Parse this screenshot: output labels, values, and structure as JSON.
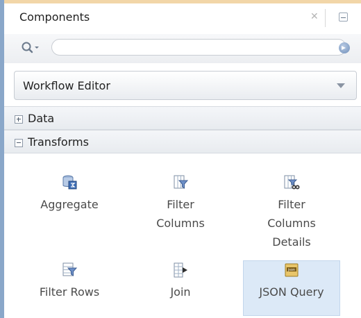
{
  "panel": {
    "title": "Components"
  },
  "search": {
    "value": "",
    "placeholder": ""
  },
  "dropdown": {
    "selected": "Workflow Editor"
  },
  "groups": [
    {
      "label": "Data",
      "expanded": false
    },
    {
      "label": "Transforms",
      "expanded": true
    }
  ],
  "tiles": [
    {
      "label": "Aggregate",
      "icon": "aggregate-icon",
      "selected": false
    },
    {
      "label": "Filter\nColumns",
      "icon": "filter-columns-icon",
      "selected": false
    },
    {
      "label": "Filter\nColumns\nDetails",
      "icon": "filter-columns-details-icon",
      "selected": false
    },
    {
      "label": "Filter Rows",
      "icon": "filter-rows-icon",
      "selected": false
    },
    {
      "label": "Join",
      "icon": "join-icon",
      "selected": false
    },
    {
      "label": "JSON Query",
      "icon": "json-query-icon",
      "selected": true
    }
  ],
  "colors": {
    "accent_border": "#8aa7c9",
    "top_accent": "#f2d6a8",
    "selected_tile": "#dce9f7"
  }
}
